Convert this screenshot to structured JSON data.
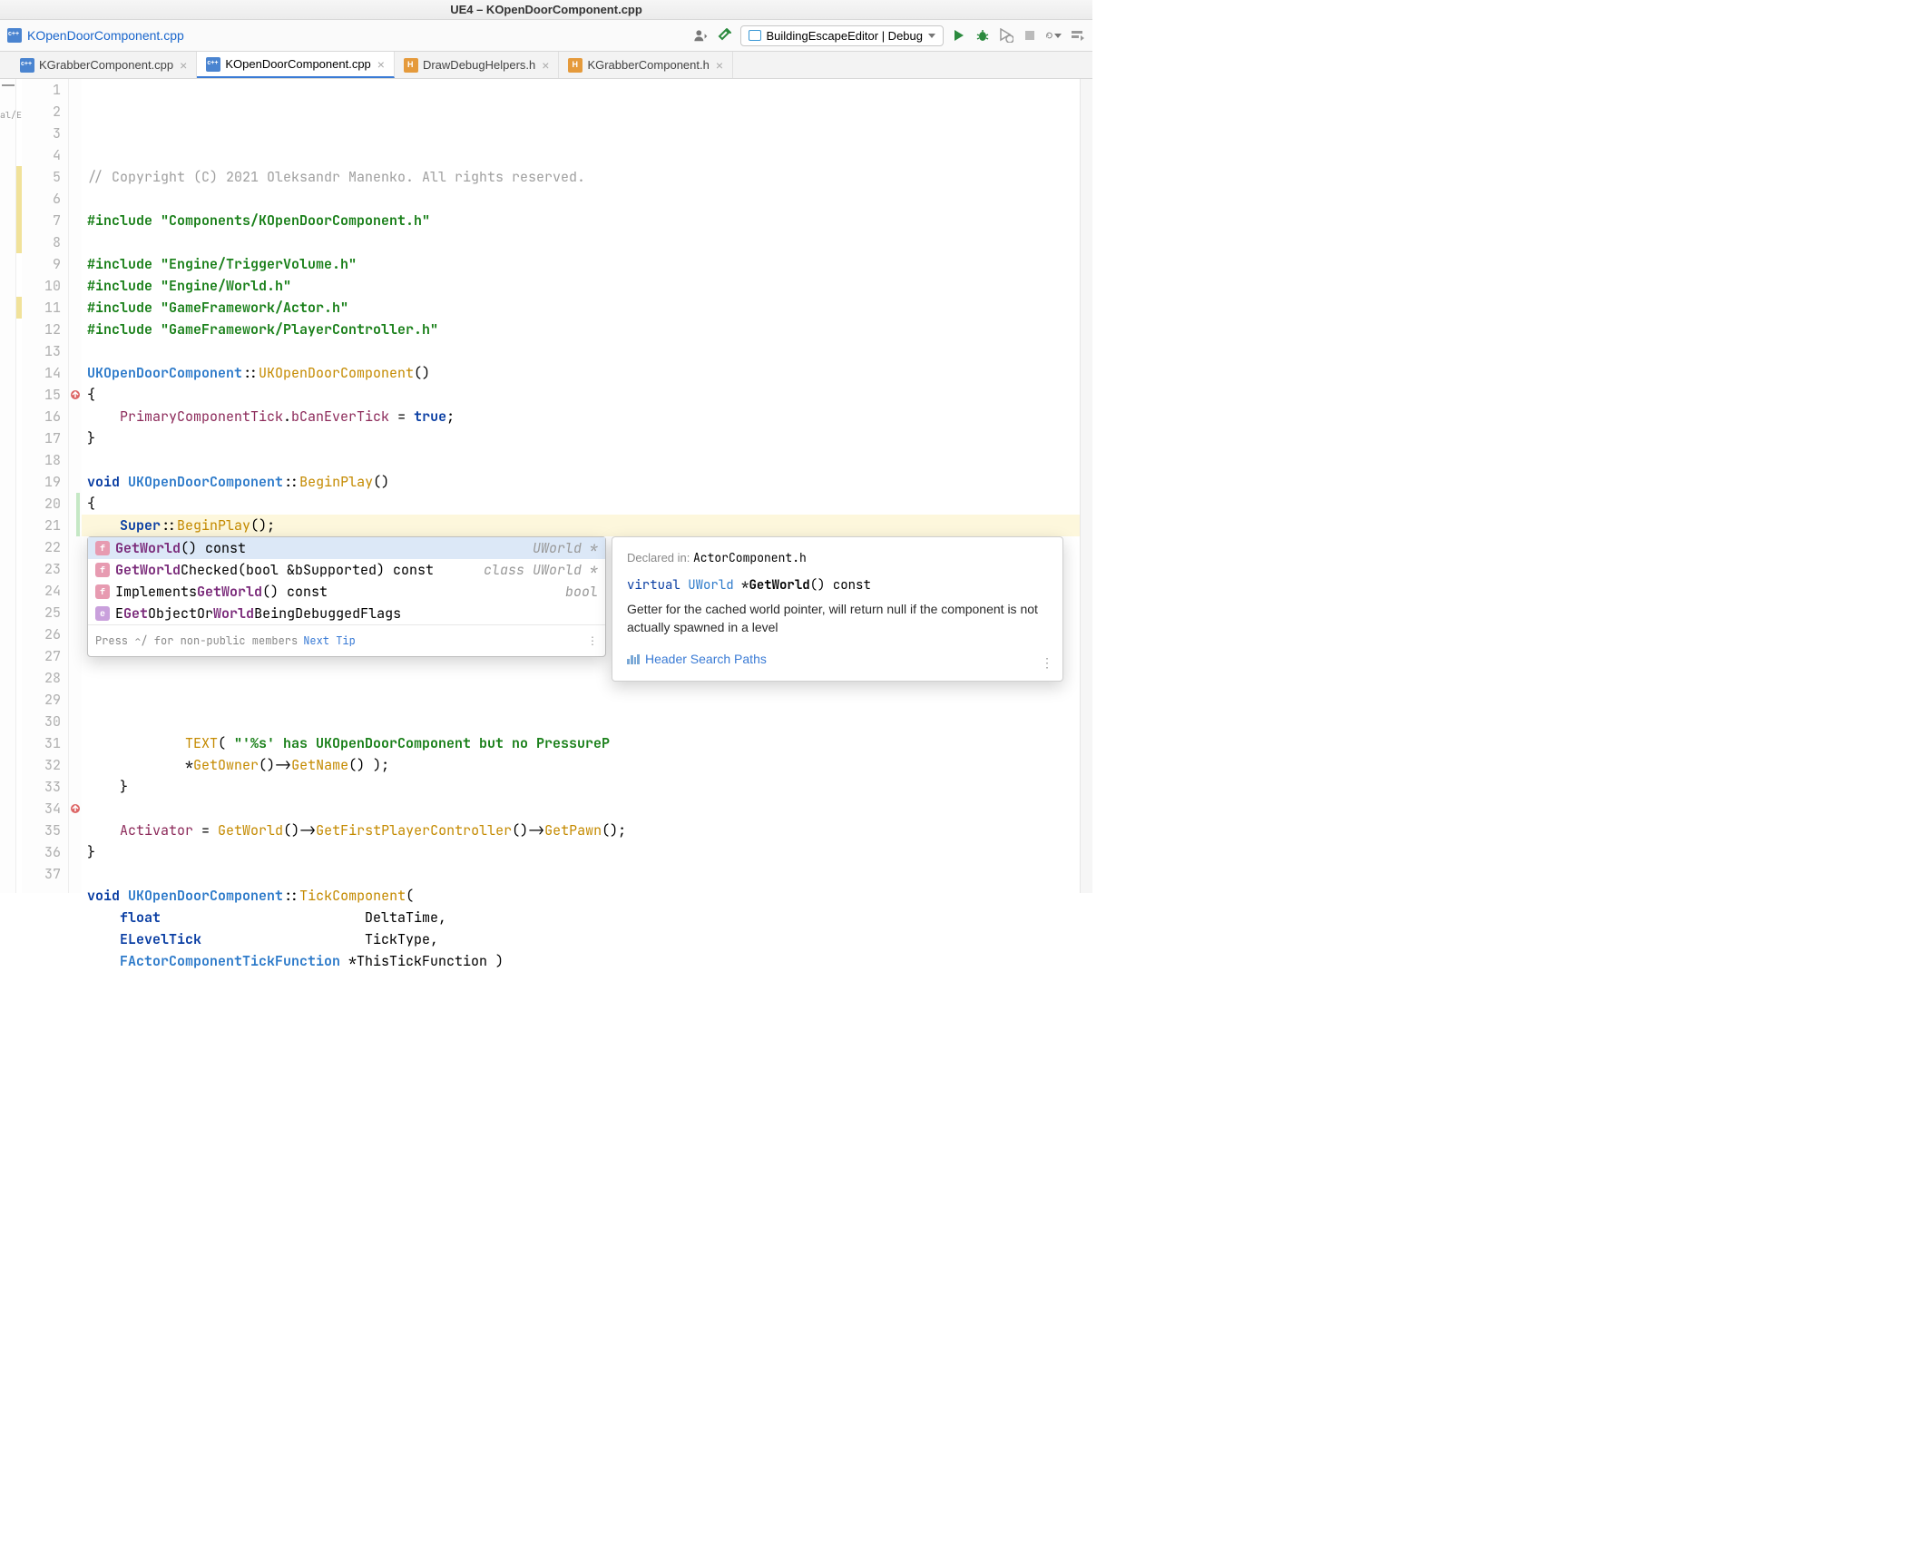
{
  "window": {
    "title": "UE4 – KOpenDoorComponent.cpp"
  },
  "navbar": {
    "path": "KOpenDoorComponent.cpp",
    "config": "BuildingEscapeEditor | Debug"
  },
  "left_gutter_label": "al/E",
  "tabs": [
    {
      "name": "KGrabberComponent.cpp",
      "icon": "cpp",
      "active": false
    },
    {
      "name": "KOpenDoorComponent.cpp",
      "icon": "cpp",
      "active": true
    },
    {
      "name": "DrawDebugHelpers.h",
      "icon": "h",
      "active": false
    },
    {
      "name": "KGrabberComponent.h",
      "icon": "h",
      "active": false
    }
  ],
  "code": {
    "lines": [
      {
        "n": 1,
        "t": "comment",
        "text": "// Copyright (C) 2021 Oleksandr Manenko. All rights reserved."
      },
      {
        "n": 2,
        "t": "blank",
        "text": ""
      },
      {
        "n": 3,
        "t": "include",
        "macro": "#include",
        "str": "\"Components/KOpenDoorComponent.h\""
      },
      {
        "n": 4,
        "t": "blank",
        "text": ""
      },
      {
        "n": 5,
        "t": "include",
        "macro": "#include",
        "str": "\"Engine/TriggerVolume.h\""
      },
      {
        "n": 6,
        "t": "include",
        "macro": "#include",
        "str": "\"Engine/World.h\""
      },
      {
        "n": 7,
        "t": "include",
        "macro": "#include",
        "str": "\"GameFramework/Actor.h\""
      },
      {
        "n": 8,
        "t": "include",
        "macro": "#include",
        "str": "\"GameFramework/PlayerController.h\""
      },
      {
        "n": 9,
        "t": "blank",
        "text": ""
      },
      {
        "n": 10,
        "t": "ctor",
        "cls": "UKOpenDoorComponent",
        "fn": "UKOpenDoorComponent",
        "suffix": "()"
      },
      {
        "n": 11,
        "t": "plain",
        "text": "{"
      },
      {
        "n": 12,
        "t": "stmt_assign",
        "indent": "    ",
        "lhs_field": "PrimaryComponentTick",
        "dot": ".",
        "member": "bCanEverTick",
        "eq": " = ",
        "rhs_kw": "true",
        "semi": ";"
      },
      {
        "n": 13,
        "t": "plain",
        "text": "}"
      },
      {
        "n": 14,
        "t": "blank",
        "text": ""
      },
      {
        "n": 15,
        "t": "funcdecl",
        "kw": "void",
        "cls": "UKOpenDoorComponent",
        "fn": "BeginPlay",
        "suffix": "()"
      },
      {
        "n": 16,
        "t": "plain",
        "text": "{"
      },
      {
        "n": 17,
        "t": "super",
        "indent": "    ",
        "text": "Super::BeginPlay();"
      },
      {
        "n": 18,
        "t": "blank",
        "text": ""
      },
      {
        "n": 19,
        "t": "initialyaw",
        "indent": "    "
      },
      {
        "n": 20,
        "t": "dots",
        "indent": "    "
      },
      {
        "n": 21,
        "t": "getworld",
        "indent": "    ",
        "text": "GetWorld"
      },
      {
        "n": 22,
        "t": "hidden",
        "text": ""
      },
      {
        "n": 23,
        "t": "hidden",
        "text": ""
      },
      {
        "n": 24,
        "t": "hidden",
        "text": ""
      },
      {
        "n": 25,
        "t": "hidden",
        "text": ""
      },
      {
        "n": 26,
        "t": "hidden",
        "text": ""
      },
      {
        "n": 27,
        "t": "textline",
        "indent": "            ",
        "pre": "TEXT( ",
        "str": "\"'%s' has UKOpenDoorComponent but no PressureP"
      },
      {
        "n": 28,
        "t": "getname",
        "indent": "            ",
        "text": "*GetOwner()->GetName() );"
      },
      {
        "n": 29,
        "t": "plain",
        "text": "    }"
      },
      {
        "n": 30,
        "t": "blank",
        "text": ""
      },
      {
        "n": 31,
        "t": "activator",
        "indent": "    "
      },
      {
        "n": 32,
        "t": "plain",
        "text": "}"
      },
      {
        "n": 33,
        "t": "blank",
        "text": ""
      },
      {
        "n": 34,
        "t": "funcdecl_open",
        "kw": "void",
        "cls": "UKOpenDoorComponent",
        "fn": "TickComponent",
        "suffix": "("
      },
      {
        "n": 35,
        "t": "param",
        "indent": "    ",
        "type": "float",
        "name": "DeltaTime",
        "comma": ","
      },
      {
        "n": 36,
        "t": "param",
        "indent": "    ",
        "type": "ELevelTick",
        "name": "TickType",
        "comma": ","
      },
      {
        "n": 37,
        "t": "param_ptr",
        "indent": "    ",
        "type": "FActorComponentTickFunction",
        "name": "*ThisTickFunction )",
        "comma": ""
      }
    ]
  },
  "autocomplete": {
    "items": [
      {
        "kind": "f",
        "match": "GetWorld",
        "rest": "() const",
        "ret": "UWorld *",
        "selected": true
      },
      {
        "kind": "f",
        "match": "GetWorld",
        "rest": "Checked(bool &bSupported) const",
        "ret": "class UWorld *",
        "selected": false
      },
      {
        "kind": "f",
        "match_pre": "Implements",
        "match": "GetWorld",
        "rest": "() const",
        "ret": "bool",
        "selected": false
      },
      {
        "kind": "e",
        "match_pre": "E",
        "match_mid1": "Get",
        "plain1": "ObjectOr",
        "match_mid2": "World",
        "plain2": "BeingDebuggedFlags",
        "ret": "",
        "selected": false
      }
    ],
    "footer_hint": "Press ⌃/ for non-public members",
    "footer_tip": "Next Tip"
  },
  "doc": {
    "declared_in_label": "Declared in:",
    "declared_in_value": "ActorComponent.h",
    "sig_kw": "virtual",
    "sig_type": "UWorld",
    "sig_ptr": " *",
    "sig_fn": "GetWorld",
    "sig_rest": "() const",
    "body": "Getter for the cached world pointer, will return null if the component is not actually spawned in a level",
    "link": "Header Search Paths"
  }
}
